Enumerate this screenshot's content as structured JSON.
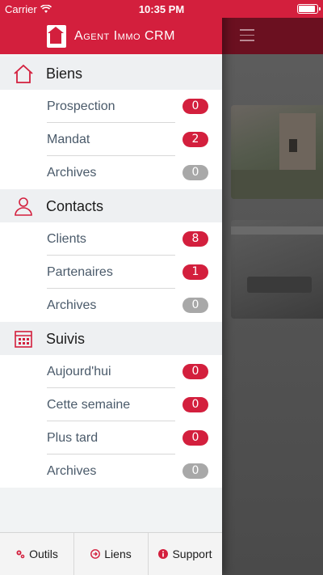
{
  "status_bar": {
    "carrier": "Carrier",
    "time": "10:35 PM"
  },
  "header": {
    "title": "Agent Immo CRM"
  },
  "colors": {
    "accent": "#d31f3d",
    "badge_grey": "#a8a8a8"
  },
  "sections": [
    {
      "title": "Biens",
      "icon": "house-icon",
      "items": [
        {
          "label": "Prospection",
          "count": "0",
          "badge": "red"
        },
        {
          "label": "Mandat",
          "count": "2",
          "badge": "red"
        },
        {
          "label": "Archives",
          "count": "0",
          "badge": "grey"
        }
      ]
    },
    {
      "title": "Contacts",
      "icon": "person-icon",
      "items": [
        {
          "label": "Clients",
          "count": "8",
          "badge": "red"
        },
        {
          "label": "Partenaires",
          "count": "1",
          "badge": "red"
        },
        {
          "label": "Archives",
          "count": "0",
          "badge": "grey"
        }
      ]
    },
    {
      "title": "Suivis",
      "icon": "calendar-icon",
      "items": [
        {
          "label": "Aujourd'hui",
          "count": "0",
          "badge": "red"
        },
        {
          "label": "Cette semaine",
          "count": "0",
          "badge": "red"
        },
        {
          "label": "Plus tard",
          "count": "0",
          "badge": "red"
        },
        {
          "label": "Archives",
          "count": "0",
          "badge": "grey"
        }
      ]
    }
  ],
  "footer": {
    "tools": "Outils",
    "links": "Liens",
    "support": "Support"
  }
}
